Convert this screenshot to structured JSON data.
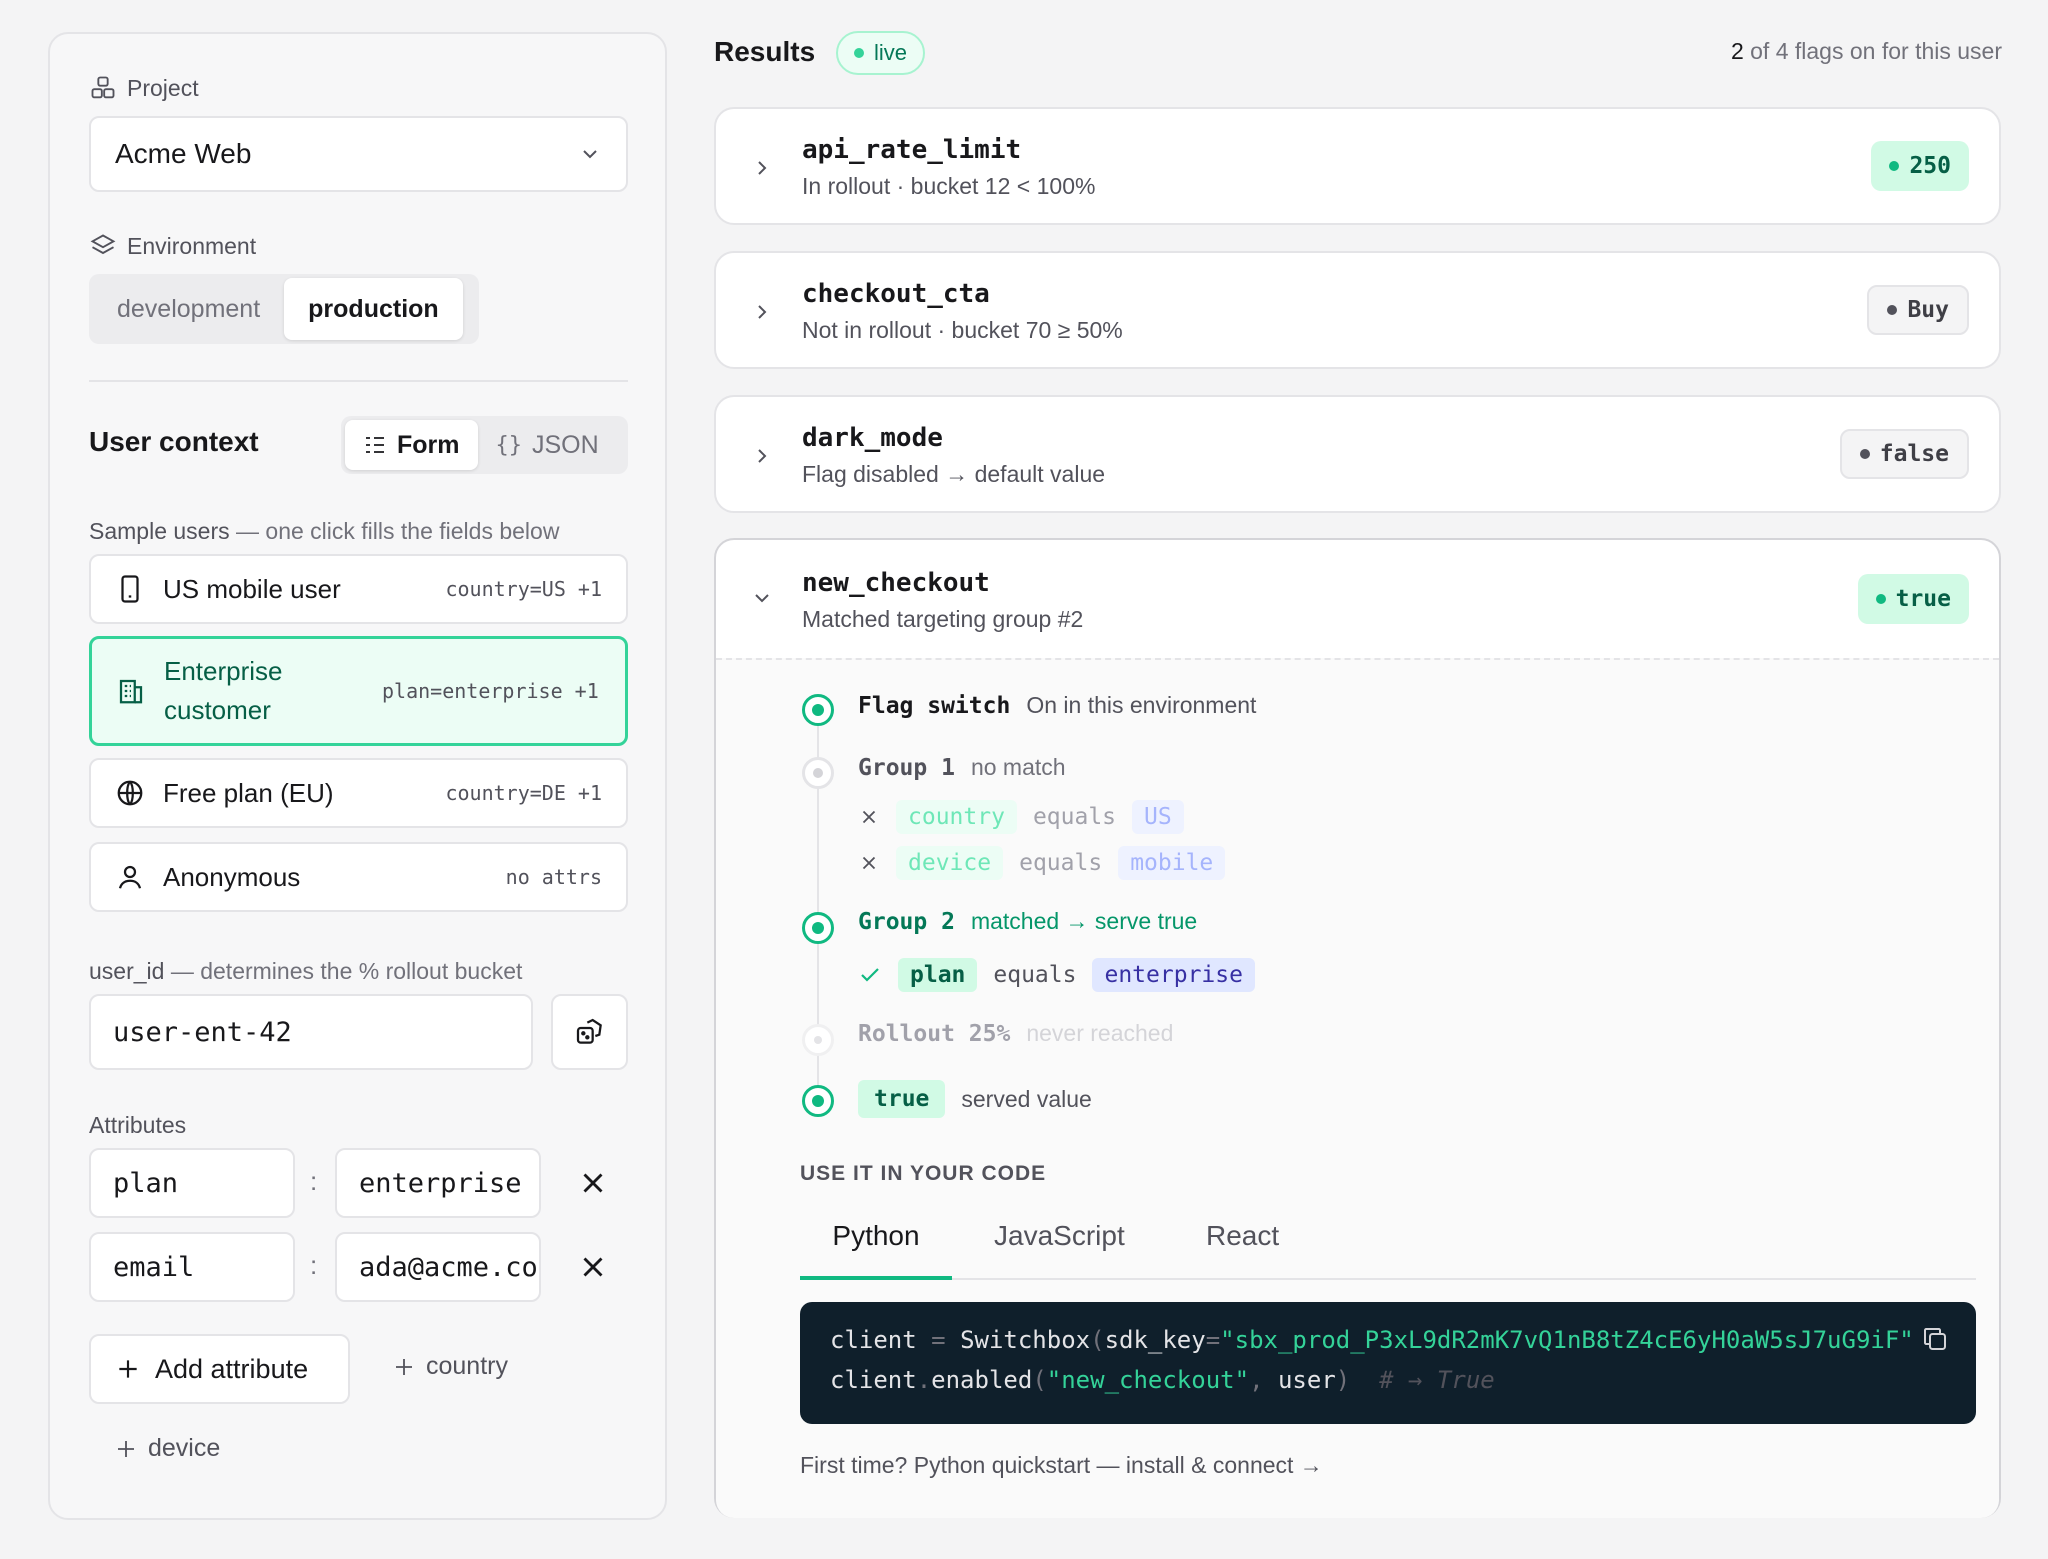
{
  "sidebar": {
    "project_label": "Project",
    "project_value": "Acme Web",
    "environment_label": "Environment",
    "environments": [
      "development",
      "production"
    ],
    "active_environment": "production",
    "user_context_title": "User context",
    "mode_form": "Form",
    "mode_json": "JSON",
    "mode_json_icon": "{}",
    "sample_users_label": "Sample users",
    "sample_users_hint": "— one click fills the fields below",
    "samples": [
      {
        "name": "US mobile user",
        "meta": "country=US +1",
        "icon": "phone-icon"
      },
      {
        "name": "Enterprise customer",
        "meta": "plan=enterprise +1",
        "icon": "building-icon",
        "selected": true
      },
      {
        "name": "Free plan (EU)",
        "meta": "country=DE +1",
        "icon": "globe-icon"
      },
      {
        "name": "Anonymous",
        "meta": "no attrs",
        "icon": "user-icon"
      }
    ],
    "user_id_label": "user_id",
    "user_id_hint": "— determines the % rollout bucket",
    "user_id_value": "user-ent-42",
    "attributes_label": "Attributes",
    "attributes": [
      {
        "key": "plan",
        "value": "enterprise"
      },
      {
        "key": "email",
        "value": "ada@acme.co"
      }
    ],
    "add_attribute_label": "Add attribute",
    "suggestions": [
      "country",
      "device"
    ]
  },
  "results": {
    "title": "Results",
    "live_label": "live",
    "summary_count": "2",
    "summary_rest": "of 4 flags on for this user",
    "flags": [
      {
        "key": "api_rate_limit",
        "desc": "In rollout · bucket 12 < 100%",
        "value": "250",
        "on": true
      },
      {
        "key": "checkout_cta",
        "desc": "Not in rollout · bucket 70 ≥ 50%",
        "value": "Buy",
        "on": false
      },
      {
        "key": "dark_mode",
        "desc": "Flag disabled → default value",
        "value": "false",
        "on": false
      },
      {
        "key": "new_checkout",
        "desc": "Matched targeting group #2",
        "value": "true",
        "on": true
      }
    ],
    "trace": {
      "switch_title": "Flag switch",
      "switch_note": "On in this environment",
      "group1_title": "Group 1",
      "group1_note": "no match",
      "group1_conditions": [
        {
          "attr": "country",
          "op": "equals",
          "val": "US"
        },
        {
          "attr": "device",
          "op": "equals",
          "val": "mobile"
        }
      ],
      "group2_title": "Group 2",
      "group2_note": "matched → serve true",
      "group2_conditions": [
        {
          "attr": "plan",
          "op": "equals",
          "val": "enterprise"
        }
      ],
      "rollout_title": "Rollout 25%",
      "rollout_note": "never reached",
      "served_value": "true",
      "served_label": "served value"
    },
    "code": {
      "heading": "USE IT IN YOUR CODE",
      "tabs": [
        "Python",
        "JavaScript",
        "React"
      ],
      "active_tab": "Python",
      "line1_var": "client",
      "line1_eq": "=",
      "line1_cls": "Switchbox",
      "line1_arg": "sdk_key",
      "line1_str": "\"sbx_prod_P3xL9dR2mK7vQ1nB8tZ4cE6yH0aW5sJ7uG9iF\"",
      "line2_obj": "client",
      "line2_method": "enabled",
      "line2_str": "\"new_checkout\"",
      "line2_arg": "user",
      "line2_comment": "# → True",
      "quickstart": "First time? Python quickstart — install & connect →"
    }
  },
  "colors": {
    "accent": "#10b981",
    "accent_light": "#d1fae5",
    "code_bg": "#0f1f2b"
  }
}
